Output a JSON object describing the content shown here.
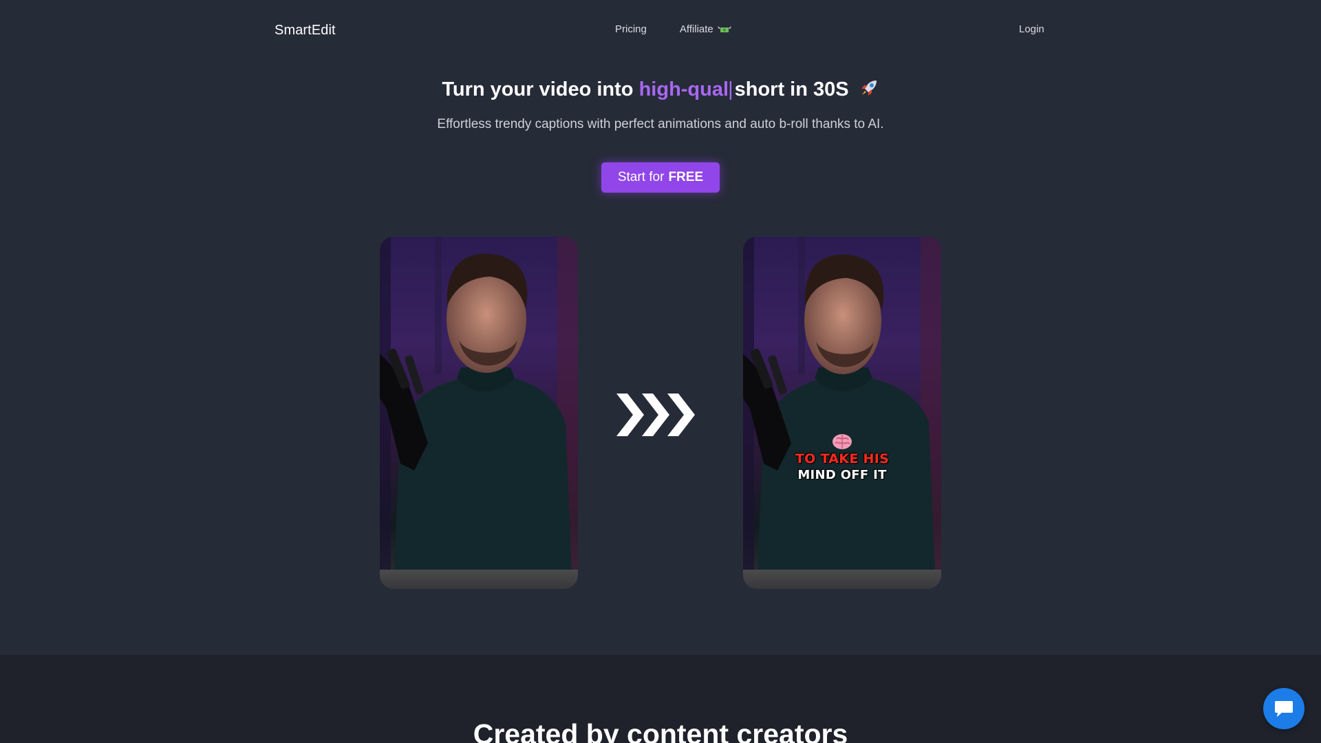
{
  "nav": {
    "brand": "SmartEdit",
    "links": [
      {
        "label": "Pricing"
      },
      {
        "label": "Affiliate",
        "icon": "money-with-wings-icon"
      }
    ],
    "login": "Login"
  },
  "hero": {
    "title_before": "Turn your video into",
    "title_accent": "high-qual",
    "title_cursor": "|",
    "title_after": "short in 30S",
    "title_icon": "rocket-icon",
    "subtitle": "Effortless trendy captions with perfect animations and auto b-roll thanks to AI.",
    "cta_prefix": "Start for",
    "cta_bold": "FREE"
  },
  "demo": {
    "before_video": {
      "icon": "person-with-microphone"
    },
    "after_video": {
      "caption_icon": "brain-icon",
      "caption_line1": "TO TAKE HIS",
      "caption_line2": "MIND OFF IT"
    },
    "transition_icon": "triple-chevron-right-icon"
  },
  "section_2": {
    "title": "Created by content creators"
  },
  "chat": {
    "icon": "chat-icon"
  },
  "colors": {
    "background": "#262b38",
    "section_2_background": "#1f222b",
    "accent": "#a868f2",
    "cta": "#9046e8",
    "caption_red": "#ff2a1f",
    "chat": "#1c7ce8"
  }
}
